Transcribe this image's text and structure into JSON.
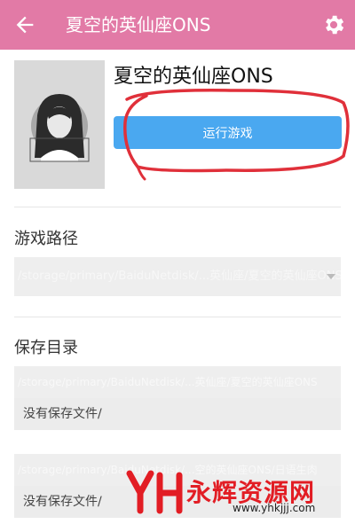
{
  "appbar": {
    "title": "夏空的英仙座ONS",
    "icons": [
      "back-arrow-icon",
      "gear-icon"
    ],
    "color": "#e27aa6"
  },
  "game": {
    "title": "夏空的英仙座ONS",
    "run_button_label": "运行游戏",
    "button_color": "#4aa8f0"
  },
  "sections": {
    "game_path": {
      "label": "游戏路径",
      "value": "/storage/primary/BaiduNetdisk/...英仙座/夏空的英仙座ONS"
    },
    "save_dir": {
      "label": "保存目录",
      "entries": [
        {
          "path": "/storage/primary/BaiduNetdisk/...英仙座/夏空的英仙座ONS",
          "status": "没有保存文件/"
        },
        {
          "path": "/storage/primary/BaiduNetdisk/...空的英仙座ONS/日语生肉",
          "status": "没有保存文件/"
        }
      ]
    }
  },
  "watermark": {
    "name": "永辉资源网",
    "url": "www.yhkjjj.com"
  }
}
